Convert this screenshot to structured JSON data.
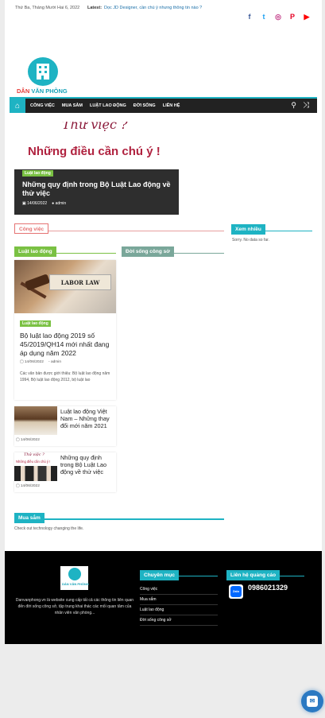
{
  "topbar": {
    "date": "Thứ Ba, Tháng Mười Hai 6, 2022",
    "latest_label": "Latest:",
    "latest_link": "Dọc JD Designer, cần chú ý nhưng thông tin nào ?",
    "social": [
      "f",
      "t",
      "◎",
      "P",
      "▶"
    ]
  },
  "logo": {
    "part1": "DÂN ",
    "part2": "VĂN PHÒNG"
  },
  "nav": {
    "items": [
      "CÔNG VIỆC",
      "MUA SẮM",
      "LUẬT LAO ĐỘNG",
      "ĐỜI SỐNG",
      "LIÊN HỆ"
    ],
    "home_icon": "⌂",
    "search_icon": "🔍",
    "shuffle_icon": "⤨"
  },
  "hero": {
    "art_line1": "Thử việc ?",
    "art_line2": "Những điều cần chú ý !",
    "tag": "Luật lao động",
    "title": "Những quy định trong Bộ Luật Lao động về thử việc",
    "date": "14/06/2022",
    "author": "admin"
  },
  "sections": {
    "cong_viec": "Công việc",
    "xem_nhieu": "Xem nhiều",
    "xem_nhieu_empty": "Sorry. No data so far.",
    "luat_lao_dong": "Luật lao động",
    "doi_song": "Đời sống công sở",
    "mua_sam": "Mua sắm",
    "mua_sam_text": "Check out technology changing the life."
  },
  "featured": {
    "image_text": "LABOR LAW",
    "tag": "Luật lao động",
    "title": "Bộ luật lao động 2019 số 45/2019/QH14 mới nhất đang áp dụng năm 2022",
    "date": "14/06/2022",
    "author": "admin",
    "excerpt": "Các văn bản được giới thiệu: Bộ luật lao động năm 1994, Bộ luật lao động 2012, bộ luật lao"
  },
  "small_posts": [
    {
      "title": "Luật lao động Việt Nam – Những thay đổi mới năm 2021",
      "date": "14/06/2022"
    },
    {
      "title": "Những quy định trong Bộ Luật Lao động về thử việc",
      "date": "14/06/2022",
      "thumb1": "Thử việc ?",
      "thumb2": "Những điều cần chú ý !"
    }
  ],
  "footer": {
    "logo_text": "DÂN VĂN PHÒNG",
    "description": "Danvanphong.vn là website cung cấp tất cả các thông tin liên quan đến đời sống công sở, tập trung khai thác các mối quan tâm của nhân viên văn phòng...",
    "chuyen_muc_title": "Chuyên mục",
    "chuyen_muc": [
      "Công việc",
      "Mua sắm",
      "Luật lao động",
      "Đời sống công sở"
    ],
    "lien_he_title": "Liên hệ quảng cáo",
    "zalo": "Zalo",
    "phone": "0986021329"
  },
  "colors": {
    "accent": "#1eb3c3",
    "green": "#7ac143",
    "dark": "#222222",
    "pink": "#d9534f"
  }
}
